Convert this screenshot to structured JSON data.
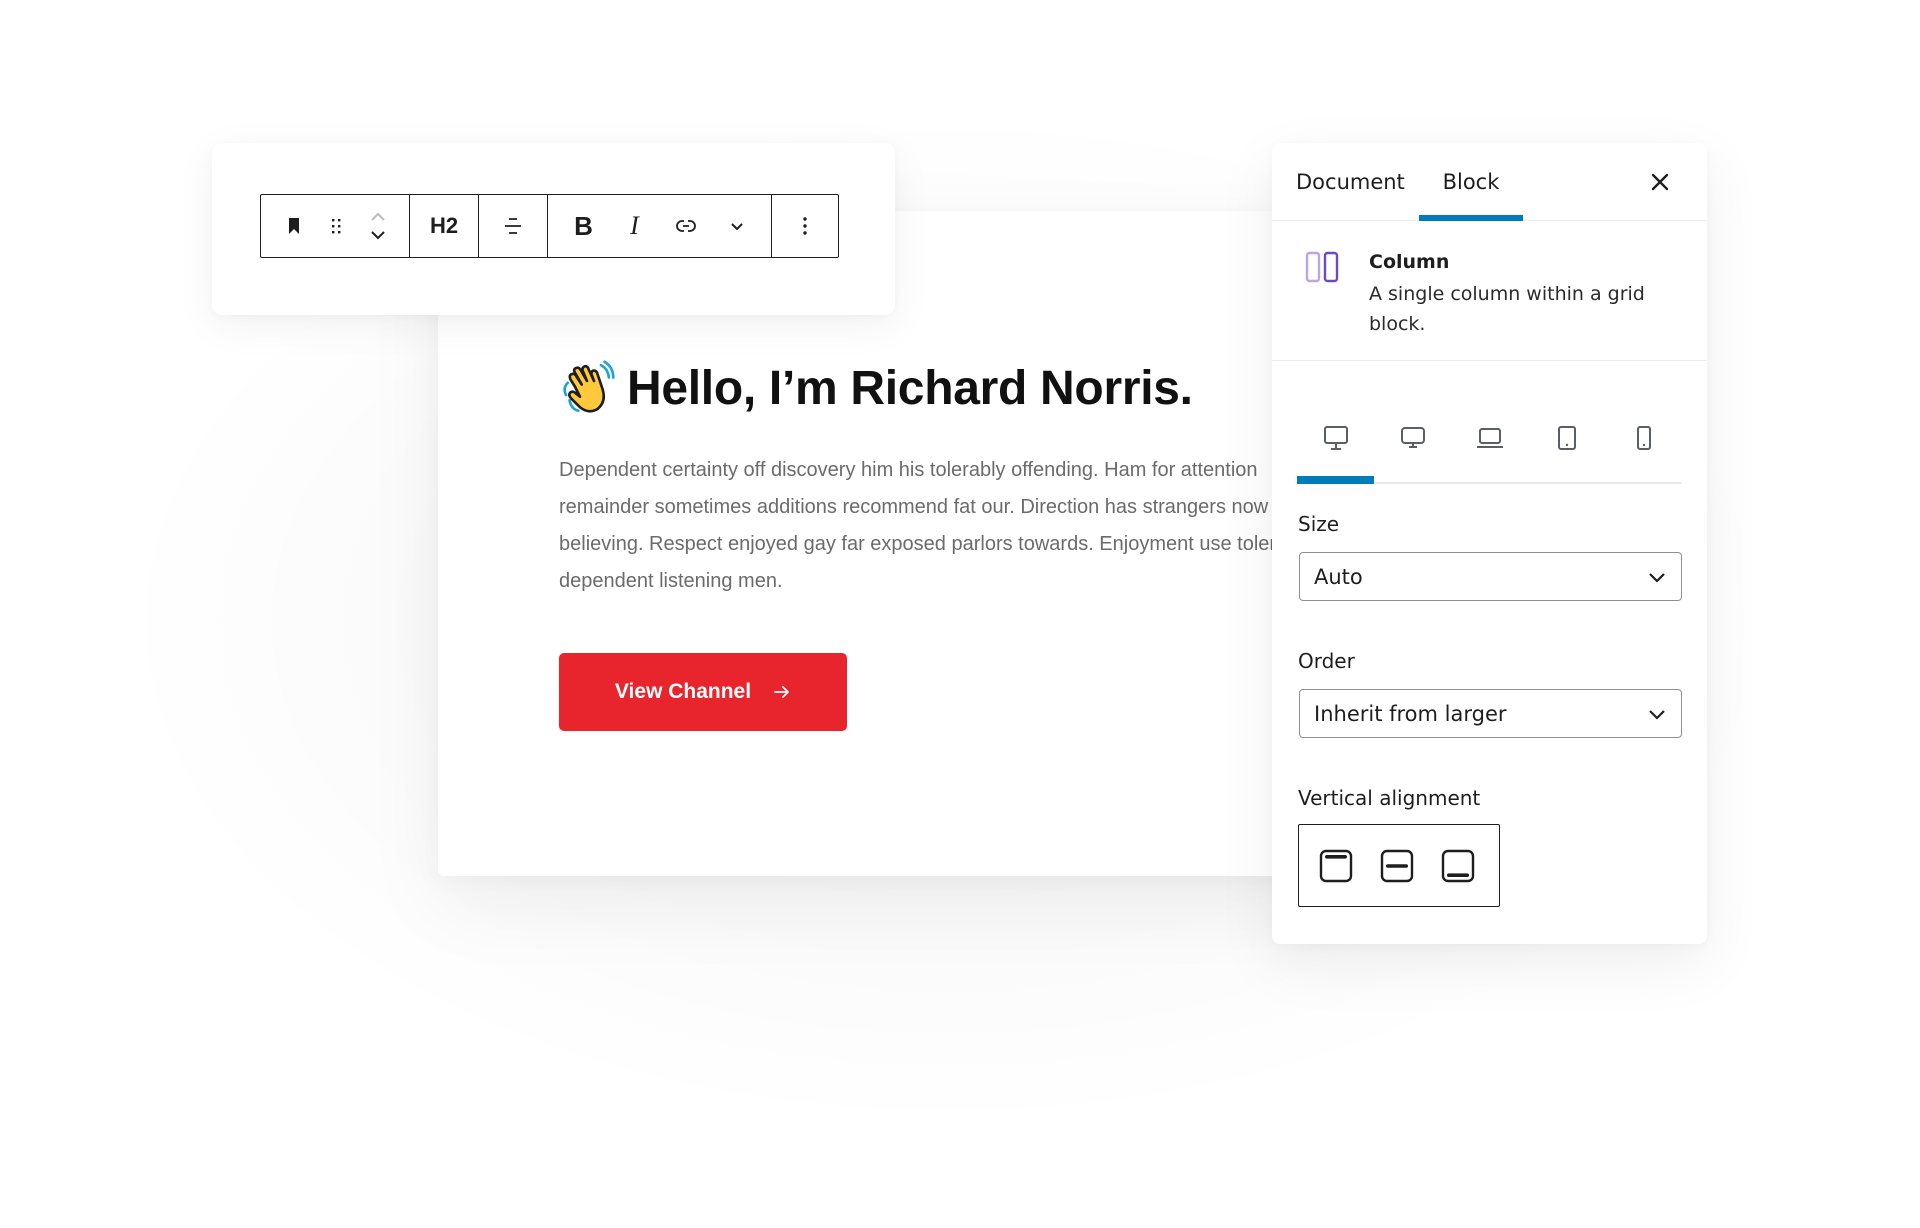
{
  "toolbar": {
    "heading_level": "H2",
    "bold_label": "B",
    "italic_label": "I",
    "icons": [
      "bookmark-icon",
      "drag-handle-icon",
      "move-up-icon",
      "move-down-icon",
      "align-center-icon",
      "link-icon",
      "chevron-down-icon",
      "more-vertical-icon"
    ]
  },
  "content": {
    "title": "Hello, I’m Richard Norris.",
    "title_icon": "waving-hand-icon",
    "paragraph": "Dependent certainty off discovery him his tolerably offending. Ham for attention remainder sometimes additions recommend fat our. Direction has strangers now believing. Respect enjoyed gay far exposed parlors towards. Enjoyment use tolerably dependent listening men.",
    "cta_label": "View Channel",
    "cta_icon": "arrow-right-icon",
    "accent_color": "#e8242d"
  },
  "panel": {
    "tabs": [
      {
        "label": "Document",
        "active": false
      },
      {
        "label": "Block",
        "active": true
      }
    ],
    "tab_accent_color": "#007cba",
    "block": {
      "name": "Column",
      "description": "A single column within a grid block.",
      "icon": "column-icon"
    },
    "devices": [
      {
        "name": "desktop-large",
        "active": true
      },
      {
        "name": "desktop",
        "active": false
      },
      {
        "name": "laptop",
        "active": false
      },
      {
        "name": "tablet",
        "active": false
      },
      {
        "name": "mobile",
        "active": false
      }
    ],
    "size": {
      "label": "Size",
      "value": "Auto"
    },
    "order": {
      "label": "Order",
      "value": "Inherit from larger"
    },
    "vertical_alignment": {
      "label": "Vertical alignment",
      "options": [
        "top",
        "center",
        "bottom"
      ]
    }
  }
}
